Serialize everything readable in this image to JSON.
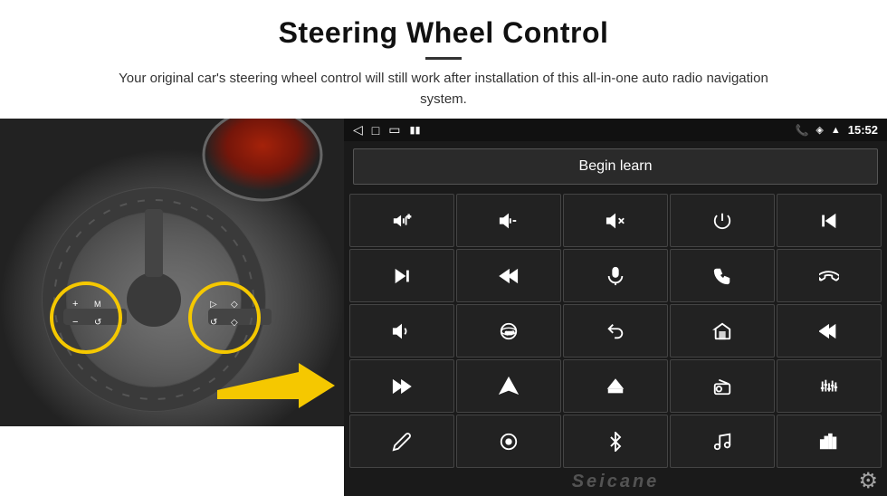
{
  "header": {
    "title": "Steering Wheel Control",
    "subtitle": "Your original car's steering wheel control will still work after installation of this all-in-one auto radio navigation system."
  },
  "status_bar": {
    "back_icon": "◁",
    "home_icon": "□",
    "recent_icon": "▭",
    "signal_icon": "▮▮",
    "time": "15:52",
    "phone_icon": "📞",
    "location_icon": "◈",
    "wifi_icon": "▲"
  },
  "begin_learn": {
    "label": "Begin learn"
  },
  "controls": [
    {
      "icon": "vol_up",
      "symbol": "🔊+"
    },
    {
      "icon": "vol_down",
      "symbol": "🔉−"
    },
    {
      "icon": "mute",
      "symbol": "🔇"
    },
    {
      "icon": "power",
      "symbol": "⏻"
    },
    {
      "icon": "prev_track",
      "symbol": "⏮"
    },
    {
      "icon": "next_track",
      "symbol": "⏭"
    },
    {
      "icon": "fast_back",
      "symbol": "⏪"
    },
    {
      "icon": "mic",
      "symbol": "🎙"
    },
    {
      "icon": "phone",
      "symbol": "📞"
    },
    {
      "icon": "hang_up",
      "symbol": "↩"
    },
    {
      "icon": "speaker",
      "symbol": "📢"
    },
    {
      "icon": "360",
      "symbol": "◉"
    },
    {
      "icon": "back",
      "symbol": "↺"
    },
    {
      "icon": "home",
      "symbol": "⌂"
    },
    {
      "icon": "skip_back",
      "symbol": "⏮"
    },
    {
      "icon": "skip_fwd",
      "symbol": "⏭"
    },
    {
      "icon": "nav",
      "symbol": "▲"
    },
    {
      "icon": "eject",
      "symbol": "⏏"
    },
    {
      "icon": "radio",
      "symbol": "📻"
    },
    {
      "icon": "equalizer",
      "symbol": "⫿"
    },
    {
      "icon": "settings2",
      "symbol": "✏"
    },
    {
      "icon": "circle_dot",
      "symbol": "⊙"
    },
    {
      "icon": "bluetooth",
      "symbol": "⚡"
    },
    {
      "icon": "music",
      "symbol": "♪"
    },
    {
      "icon": "bars",
      "symbol": "⫸"
    }
  ],
  "watermark": {
    "text": "Seicane"
  },
  "gear": {
    "symbol": "⚙"
  }
}
